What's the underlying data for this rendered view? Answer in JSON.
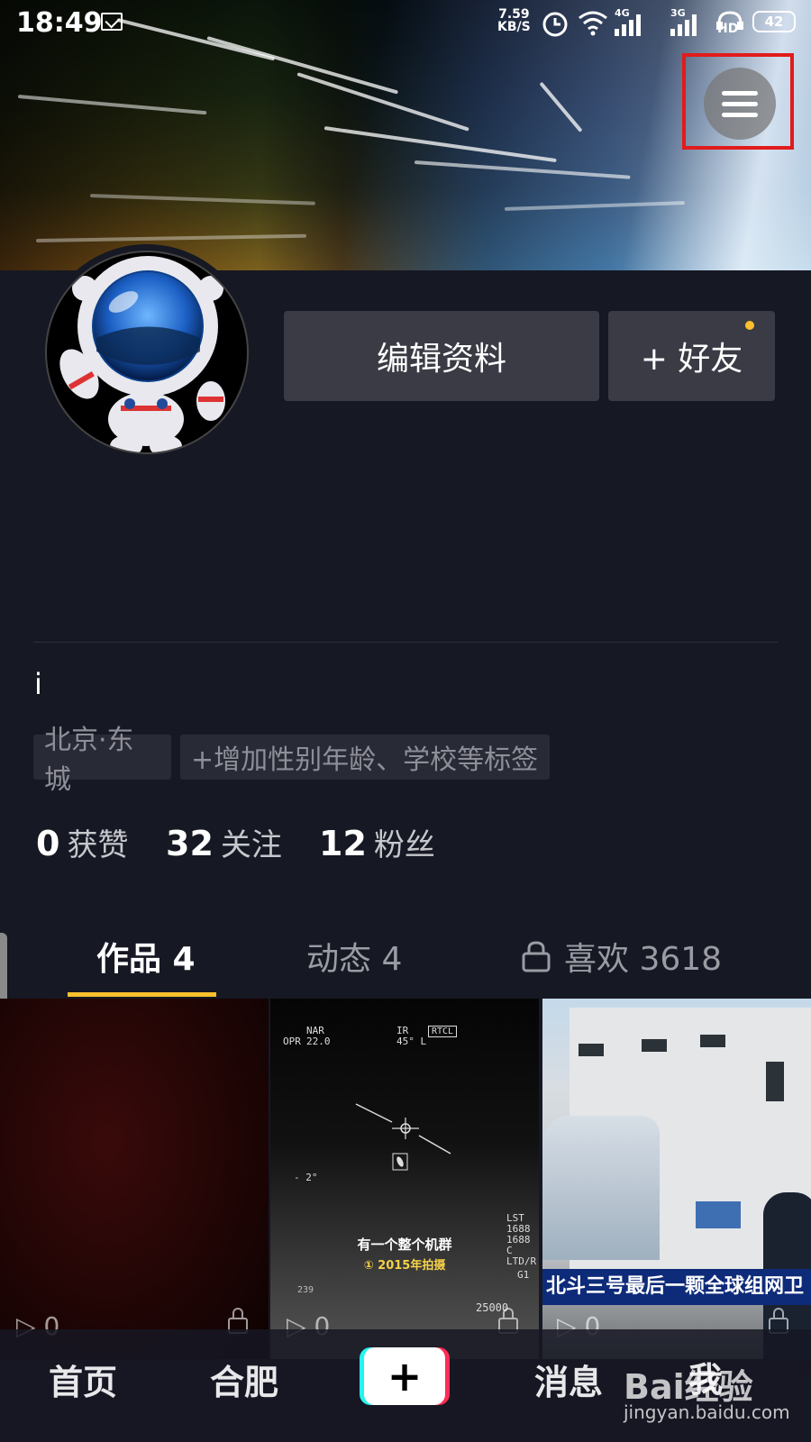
{
  "status_bar": {
    "time": "18:49",
    "speed_value": "7.59",
    "speed_unit": "KB/S",
    "net1": "4G",
    "net2": "3G",
    "hd": "HD",
    "battery": "42"
  },
  "profile": {
    "edit_label": "编辑资料",
    "add_friend_label": "+ 好友",
    "bio": "i",
    "tags": [
      "北京·东城",
      "+增加性别年龄、学校等标签"
    ],
    "stats": [
      {
        "value": "0",
        "label": "获赞"
      },
      {
        "value": "32",
        "label": "关注"
      },
      {
        "value": "12",
        "label": "粉丝"
      }
    ]
  },
  "tabs": [
    {
      "label": "作品 4",
      "active": true
    },
    {
      "label": "动态 4",
      "active": false
    },
    {
      "label": "喜欢 3618",
      "active": false,
      "icon": "lock-icon"
    }
  ],
  "videos": [
    {
      "plays": "0"
    },
    {
      "plays": "0",
      "caption": "有一个整个机群",
      "subcaption": "① 2015年拍摄",
      "hud": [
        "OPR",
        "NAR",
        "22.0",
        "IR",
        "RTCL",
        "45° L",
        "- 2°",
        "LST",
        "1688",
        "1688 C",
        "LTD/R",
        "G1",
        "25000",
        "239"
      ]
    },
    {
      "plays": "0",
      "caption": "北斗三号最后一颗全球组网卫"
    }
  ],
  "bottom_nav": {
    "items": [
      "首页",
      "合肥",
      "消息",
      "我"
    ],
    "center_icon": "plus-icon"
  },
  "watermark": {
    "brand": "Bai经验",
    "url": "jingyan.baidu.com"
  },
  "colors": {
    "background": "#161823",
    "accent": "#fbc02d",
    "highlight": "#e21b1b"
  }
}
